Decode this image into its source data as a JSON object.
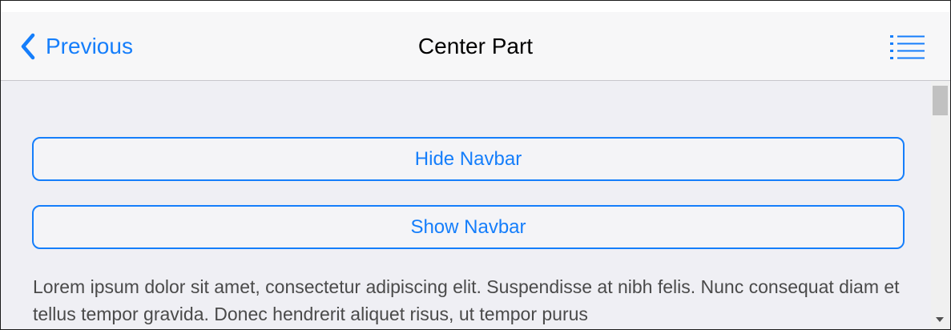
{
  "navbar": {
    "back_label": "Previous",
    "back_icon": "chevron-left-icon",
    "title": "Center Part",
    "menu_icon": "list-icon"
  },
  "content": {
    "hide_button_label": "Hide Navbar",
    "show_button_label": "Show Navbar",
    "paragraph": "Lorem ipsum dolor sit amet, consectetur adipiscing elit. Suspendisse at nibh felis. Nunc consequat diam et tellus tempor gravida. Donec hendrerit aliquet risus, ut tempor purus"
  },
  "colors": {
    "accent": "#157efb",
    "navbar_bg": "#f7f7f8",
    "page_bg": "#efeff4",
    "text": "#4a4a4a"
  }
}
